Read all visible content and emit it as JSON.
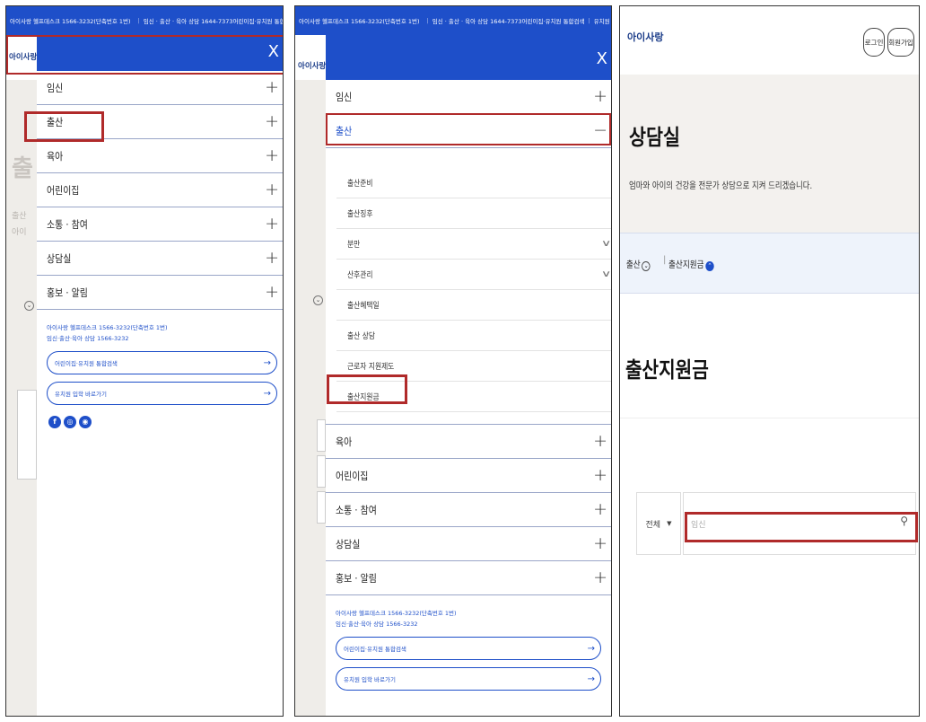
{
  "topbar": {
    "helpdesk": "아이사랑 헬프데스크 1566-3232(단축번호 1번)",
    "hotline": "임신 · 출산 · 육아 상담 1644-7373",
    "search_link": "어린이집·유치원 통합검색",
    "kinder_link": "유치원 입학 바로가기",
    "social": [
      "f",
      "◎",
      "▶"
    ]
  },
  "strip": {
    "logo": "아이사랑",
    "hero_char": "출",
    "small1": "출산",
    "small2": "아이"
  },
  "menu": {
    "close": "X",
    "items": [
      "임신",
      "출산",
      "육아",
      "어린이집",
      "소통 · 참여",
      "상담실",
      "홍보 · 알림"
    ],
    "plus": "+",
    "minus": "−",
    "info_line1": "아이사랑 헬프데스크 1566-3232(단축번호 1번)",
    "info_line2": "임신·출산·육아 상담 1566-3232",
    "pill1": "어린이집·유치원 통합검색",
    "pill2": "유치원 입학 바로가기",
    "arrow": "→",
    "socials": [
      "f",
      "◎",
      "◉"
    ]
  },
  "submenu": {
    "items": [
      "출산준비",
      "출산징후",
      "분만",
      "산후관리",
      "출산혜택일",
      "출산 상담",
      "근로자 지원제도",
      "출산지원금"
    ],
    "chevron": "∨"
  },
  "page": {
    "logo": "아이사랑",
    "login": "로그인",
    "signup": "회원가입",
    "hero_title": "상담실",
    "hero_desc": "엄마와 아이의 건강을 전문가 상담으로 지켜 드리겠습니다.",
    "crumb1": "출산",
    "crumb2": "출산지원금",
    "page_title": "출산지원금",
    "select": "전체",
    "select_arrow": "▼",
    "search_placeholder": "임신",
    "search_icon": "⚲"
  }
}
